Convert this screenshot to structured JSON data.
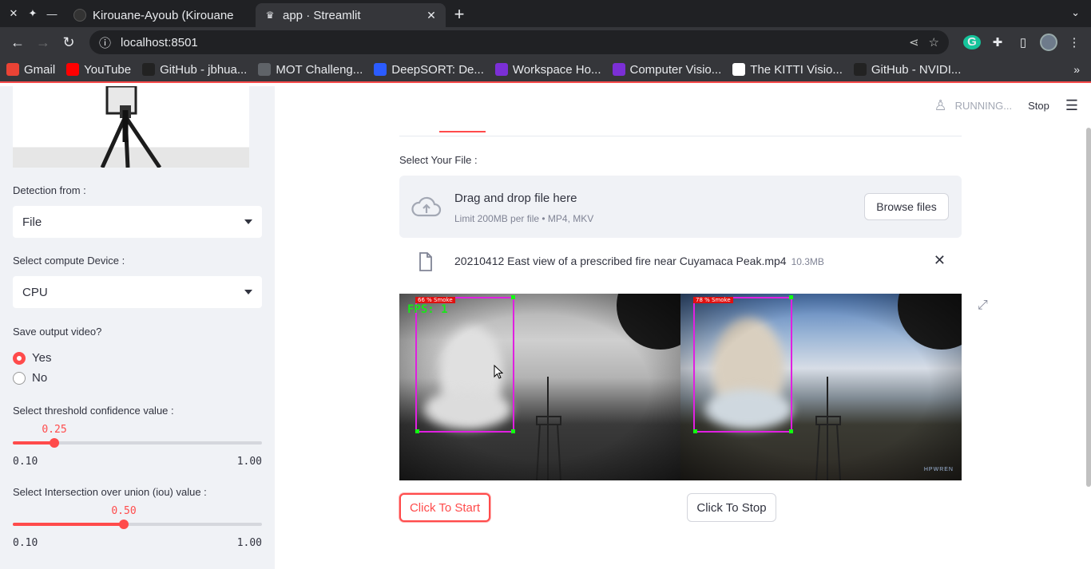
{
  "browser": {
    "tabs": [
      {
        "title": "Kirouane-Ayoub (Kirouane",
        "active": false
      },
      {
        "title": "app · Streamlit",
        "active": true
      }
    ],
    "url": "localhost:8501",
    "bookmarks": [
      {
        "label": "Gmail",
        "icon": "gmail-icon",
        "color": "#ea4335"
      },
      {
        "label": "YouTube",
        "icon": "youtube-icon",
        "color": "#ff0000"
      },
      {
        "label": "GitHub - jbhua...",
        "icon": "github-icon",
        "color": "#222222"
      },
      {
        "label": "MOT Challeng...",
        "icon": "globe-icon",
        "color": "#5f6368"
      },
      {
        "label": "DeepSORT: De...",
        "icon": "papers-icon",
        "color": "#2b5cff"
      },
      {
        "label": "Workspace Ho...",
        "icon": "workspace-icon",
        "color": "#7b2fd6"
      },
      {
        "label": "Computer Visio...",
        "icon": "workspace-icon",
        "color": "#7b2fd6"
      },
      {
        "label": "The KITTI Visio...",
        "icon": "kitti-icon",
        "color": "#ffffff"
      },
      {
        "label": "GitHub - NVIDI...",
        "icon": "github-icon",
        "color": "#222222"
      }
    ]
  },
  "sidebar": {
    "detection_label": "Detection from :",
    "detection_value": "File",
    "device_label": "Select compute Device :",
    "device_value": "CPU",
    "save_label": "Save output video?",
    "save_options": [
      "Yes",
      "No"
    ],
    "save_selected": "Yes",
    "conf_label": "Select threshold confidence value :",
    "conf_value": "0.25",
    "conf_min": "0.10",
    "conf_max": "1.00",
    "conf_fraction": 0.1667,
    "iou_label": "Select Intersection over union (iou) value :",
    "iou_value": "0.50",
    "iou_min": "0.10",
    "iou_max": "1.00",
    "iou_fraction": 0.4444
  },
  "header": {
    "status": "RUNNING...",
    "stop": "Stop"
  },
  "main": {
    "file_label": "Select Your File :",
    "dropzone_title": "Drag and drop file here",
    "dropzone_sub": "Limit 200MB per file • MP4, MKV",
    "browse": "Browse files",
    "file_name": "20210412 East view of a prescribed fire near Cuyamaca Peak.mp4",
    "file_size": "10.3MB",
    "fps_text": "FPS: 1",
    "det_gray": "66 % Smoke",
    "det_color": "78 % Smoke",
    "watermark": "HPWREN",
    "start": "Click To Start",
    "stop_btn": "Click To Stop"
  },
  "colors": {
    "accent": "#ff4b4b",
    "sidebar_bg": "#f0f2f6",
    "text": "#31333f"
  }
}
